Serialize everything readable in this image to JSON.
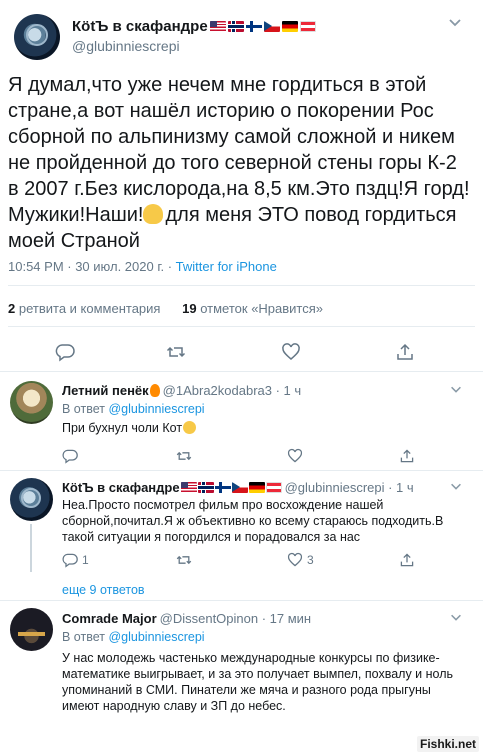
{
  "tweet": {
    "author_name": "КötЪ в скафандре",
    "author_handle": "@glubinniescrepi",
    "flags": [
      "flag-us",
      "flag-no",
      "flag-fi",
      "flag-cz",
      "flag-de",
      "flag-at"
    ],
    "text_part1": "Я думал,что уже нечем мне гордиться в этой стране,а вот нашёл историю о покорении Рос сборной по альпинизму самой сложной и никем не пройденной до того северной стены горы К-2 в 2007 г.Без кислорода,на 8,5 км.Это пздц!Я горд! Мужики!Наши!",
    "text_part2": "для меня ЭТО повод гордиться моей Страной",
    "time": "10:54 PM · 30 июл. 2020 г.",
    "source": "Twitter for iPhone",
    "retweets_count": "2",
    "retweets_label": "ретвита и комментария",
    "likes_count": "19",
    "likes_label": "отметок «Нравится»"
  },
  "replies": [
    {
      "name": "Летний пенёк",
      "handle": "@1Abra2kodabra3 · 1 ч",
      "reply_to_prefix": "В ответ",
      "reply_to": "@glubinniescrepi",
      "text": "При бухнул чоли Кот",
      "reply_count": "",
      "retweet_count": "",
      "like_count": "",
      "share_count": ""
    },
    {
      "name": "КötЪ в скафандре",
      "handle": "@glubinniescrepi · 1 ч",
      "text": "Неа.Просто посмотрел фильм про восхождение нашей сборной,почитал.Я ж объективно ко всему стараюсь подходить.В такой ситуации я погордился и порадовался за нас",
      "reply_count": "1",
      "retweet_count": "",
      "like_count": "3",
      "share_count": ""
    },
    {
      "name": "Comrade Major",
      "handle": "@DissentOpinon · 17 мин",
      "reply_to_prefix": "В ответ",
      "reply_to": "@glubinniescrepi",
      "text": "У нас молодежь частенько международные конкурсы по физике-математике выигрывает, и за это получает вымпел, похвалу и ноль упоминаний в СМИ. Пинатели же мяча и разного рода прыгуны имеют народную славу и ЗП до небес."
    }
  ],
  "more_replies": "еще 9 ответов",
  "watermark": "Fishki.net",
  "icons": [
    "chevron-down-icon",
    "reply-icon",
    "retweet-icon",
    "like-icon",
    "share-icon"
  ],
  "colors": {
    "link": "#1b95e0",
    "secondary": "#657786",
    "divider": "#e6ecf0"
  }
}
